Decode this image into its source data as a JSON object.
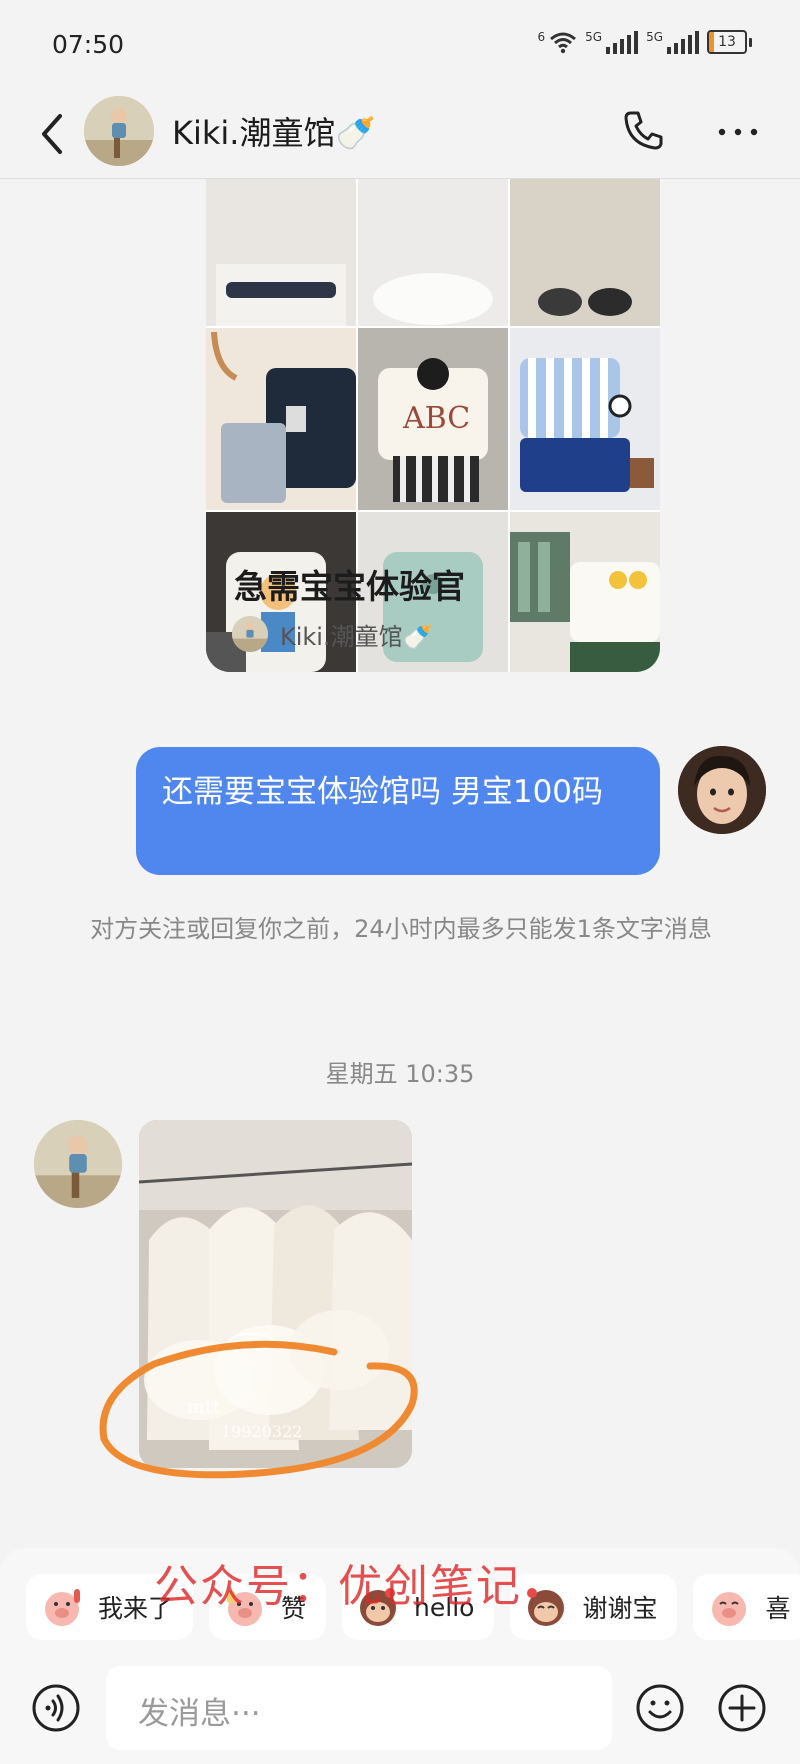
{
  "status_bar": {
    "time": "07:50",
    "wifi_label": "6",
    "net1": "5G",
    "net2": "5G",
    "battery": "13",
    "battery_level": 0.13
  },
  "header": {
    "contact_name": "Kiki.潮童馆🍼"
  },
  "shared_card": {
    "title": "急需宝宝体验官",
    "author": "Kiki.潮童馆🍼"
  },
  "messages": {
    "sent_text": "还需要宝宝体验馆吗 男宝100码",
    "system_note": "对方关注或回复你之前，24小时内最多只能发1条文字消息",
    "timestamp": "星期五 10:35",
    "photo_mark_1": "mtt",
    "photo_mark_2": "19920322"
  },
  "watermark": "公众号：优创笔记",
  "quick_replies": [
    {
      "label": "我来了",
      "icon": "pig-hand-icon"
    },
    {
      "label": "赞",
      "icon": "pig-thumbs-icon"
    },
    {
      "label": "hello",
      "icon": "monkey-hello-icon"
    },
    {
      "label": "谢谢宝",
      "icon": "monkey-thanks-icon"
    },
    {
      "label": "喜",
      "icon": "pig-happy-icon"
    }
  ],
  "composer": {
    "placeholder": "发消息···"
  },
  "colors": {
    "accent": "#4f87ee",
    "annotation": "#f08a32",
    "watermark": "#e12828"
  }
}
